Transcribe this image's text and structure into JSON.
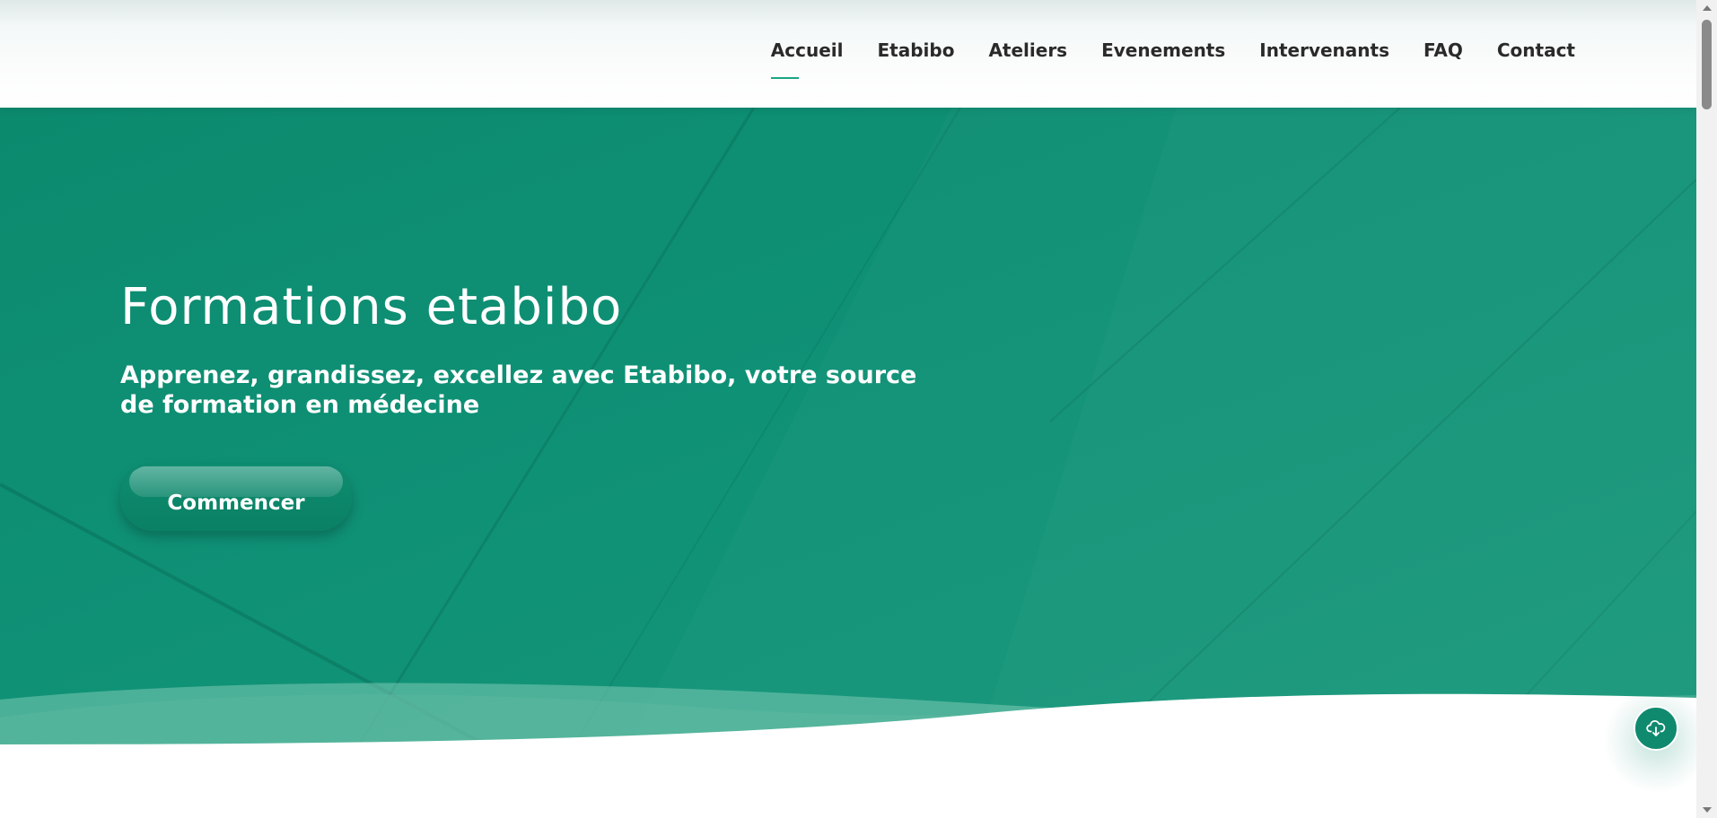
{
  "nav": {
    "items": [
      {
        "label": "Accueil",
        "active": true
      },
      {
        "label": "Etabibo",
        "active": false
      },
      {
        "label": "Ateliers",
        "active": false
      },
      {
        "label": "Evenements",
        "active": false
      },
      {
        "label": "Intervenants",
        "active": false
      },
      {
        "label": "FAQ",
        "active": false
      },
      {
        "label": "Contact",
        "active": false
      }
    ]
  },
  "hero": {
    "title": "Formations etabibo",
    "subtitle": "Apprenez, grandissez, excellez avec Etabibo, votre source de formation en médecine",
    "cta_label": "Commencer"
  },
  "floating_button": {
    "icon": "cloud-download-icon"
  },
  "colors": {
    "brand_green": "#0f8a6e",
    "active_underline": "#1aa584"
  }
}
